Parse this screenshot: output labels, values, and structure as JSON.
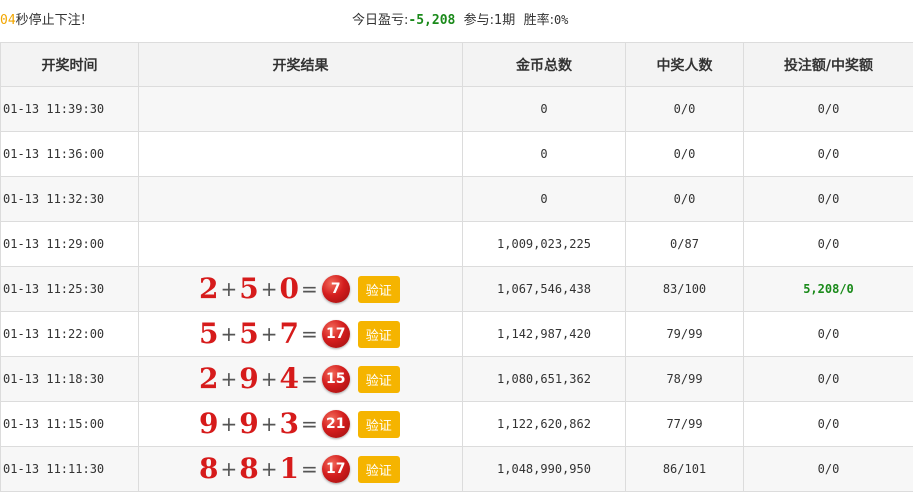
{
  "header": {
    "countdown_number": "04",
    "countdown_text": "秒停止下注!",
    "profit_label": "今日盈亏:",
    "profit_value": "-5,208",
    "participate_label": "参与:",
    "participate_value": "1期",
    "winrate_label": "胜率:",
    "winrate_value": "0%"
  },
  "table": {
    "columns": [
      "开奖时间",
      "开奖结果",
      "金币总数",
      "中奖人数",
      "投注额/中奖额"
    ],
    "verify_label": "验证",
    "rows": [
      {
        "time": "01-13 11:39:30",
        "result": null,
        "coins": "0",
        "winners": "0/0",
        "bet_win": "0/0",
        "highlight": false
      },
      {
        "time": "01-13 11:36:00",
        "result": null,
        "coins": "0",
        "winners": "0/0",
        "bet_win": "0/0",
        "highlight": false
      },
      {
        "time": "01-13 11:32:30",
        "result": null,
        "coins": "0",
        "winners": "0/0",
        "bet_win": "0/0",
        "highlight": false
      },
      {
        "time": "01-13 11:29:00",
        "result": null,
        "coins": "1,009,023,225",
        "winners": "0/87",
        "bet_win": "0/0",
        "highlight": false
      },
      {
        "time": "01-13 11:25:30",
        "result": {
          "a": "2",
          "b": "5",
          "c": "0",
          "sum": "7"
        },
        "coins": "1,067,546,438",
        "winners": "83/100",
        "bet_win": "5,208/0",
        "highlight": true
      },
      {
        "time": "01-13 11:22:00",
        "result": {
          "a": "5",
          "b": "5",
          "c": "7",
          "sum": "17"
        },
        "coins": "1,142,987,420",
        "winners": "79/99",
        "bet_win": "0/0",
        "highlight": false
      },
      {
        "time": "01-13 11:18:30",
        "result": {
          "a": "2",
          "b": "9",
          "c": "4",
          "sum": "15"
        },
        "coins": "1,080,651,362",
        "winners": "78/99",
        "bet_win": "0/0",
        "highlight": false
      },
      {
        "time": "01-13 11:15:00",
        "result": {
          "a": "9",
          "b": "9",
          "c": "3",
          "sum": "21"
        },
        "coins": "1,122,620,862",
        "winners": "77/99",
        "bet_win": "0/0",
        "highlight": false
      },
      {
        "time": "01-13 11:11:30",
        "result": {
          "a": "8",
          "b": "8",
          "c": "1",
          "sum": "17"
        },
        "coins": "1,048,990,950",
        "winners": "86/101",
        "bet_win": "0/0",
        "highlight": false
      }
    ]
  }
}
